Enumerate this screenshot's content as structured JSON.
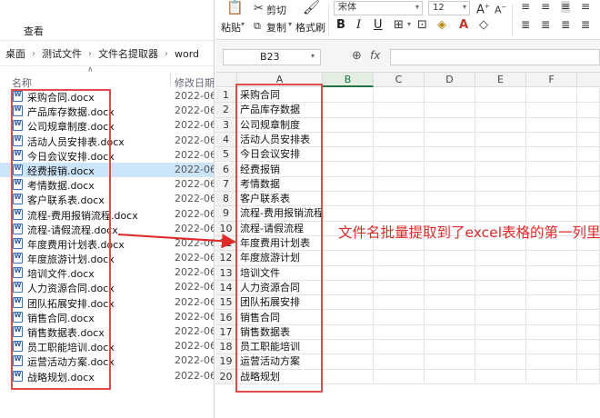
{
  "explorer": {
    "view_tab": "查看",
    "breadcrumb": [
      "桌面",
      "测试文件",
      "文件名提取器",
      "word"
    ],
    "columns": {
      "name": "名称",
      "date": "修改日期"
    },
    "files": [
      {
        "name": "采购合同.docx",
        "date": "2022-06-"
      },
      {
        "name": "产品库存数据.docx",
        "date": "2022-06-"
      },
      {
        "name": "公司规章制度.docx",
        "date": "2022-06-"
      },
      {
        "name": "活动人员安排表.docx",
        "date": "2022-06-"
      },
      {
        "name": "今日会议安排.docx",
        "date": "2022-06-"
      },
      {
        "name": "经费报销.docx",
        "date": "2022-06-"
      },
      {
        "name": "考情数据.docx",
        "date": "2022-06-"
      },
      {
        "name": "客户联系表.docx",
        "date": "2022-06-"
      },
      {
        "name": "流程-费用报销流程.docx",
        "date": "2022-06-"
      },
      {
        "name": "流程-请假流程.docx",
        "date": "2022-06-"
      },
      {
        "name": "年度费用计划表.docx",
        "date": "2022-06-"
      },
      {
        "name": "年度旅游计划.docx",
        "date": "2022-06-"
      },
      {
        "name": "培训文件.docx",
        "date": "2022-06-"
      },
      {
        "name": "人力资源合同.docx",
        "date": "2022-06-"
      },
      {
        "name": "团队拓展安排.docx",
        "date": "2022-06-"
      },
      {
        "name": "销售合同.docx",
        "date": "2022-06-"
      },
      {
        "name": "销售数据表.docx",
        "date": "2022-06-"
      },
      {
        "name": "员工职能培训.docx",
        "date": "2022-06-"
      },
      {
        "name": "运营活动方案.docx",
        "date": "2022-06-"
      },
      {
        "name": "战略规划.docx",
        "date": "2022-06-"
      }
    ],
    "selected_index": 5
  },
  "ribbon": {
    "paste": "粘贴",
    "cut": "剪切",
    "copy": "复制",
    "format_painter": "格式刷",
    "font_name": "宋体",
    "font_size": "12",
    "bold": "B",
    "italic": "I",
    "underline": "U"
  },
  "formula_bar": {
    "cell_ref": "B23",
    "fx": "fx",
    "value": ""
  },
  "sheet": {
    "columns": [
      "A",
      "B",
      "C",
      "D",
      "E",
      "F"
    ],
    "active_column": "B",
    "rows": [
      {
        "num": "1",
        "a": "采购合同"
      },
      {
        "num": "2",
        "a": "产品库存数据"
      },
      {
        "num": "3",
        "a": "公司规章制度"
      },
      {
        "num": "4",
        "a": "活动人员安排表"
      },
      {
        "num": "5",
        "a": "今日会议安排"
      },
      {
        "num": "6",
        "a": "经费报销"
      },
      {
        "num": "7",
        "a": "考情数据"
      },
      {
        "num": "8",
        "a": "客户联系表"
      },
      {
        "num": "9",
        "a": "流程-费用报销流程"
      },
      {
        "num": "10",
        "a": "流程-请假流程"
      },
      {
        "num": "11",
        "a": "年度费用计划表"
      },
      {
        "num": "12",
        "a": "年度旅游计划"
      },
      {
        "num": "13",
        "a": "培训文件"
      },
      {
        "num": "14",
        "a": "人力资源合同"
      },
      {
        "num": "15",
        "a": "团队拓展安排"
      },
      {
        "num": "16",
        "a": "销售合同"
      },
      {
        "num": "17",
        "a": "销售数据表"
      },
      {
        "num": "18",
        "a": "员工职能培训"
      },
      {
        "num": "19",
        "a": "运营活动方案"
      },
      {
        "num": "20",
        "a": "战略规划"
      }
    ]
  },
  "annotation": {
    "text": "文件名批量提取到了excel表格的第一列里",
    "color": "#e02a2a"
  }
}
